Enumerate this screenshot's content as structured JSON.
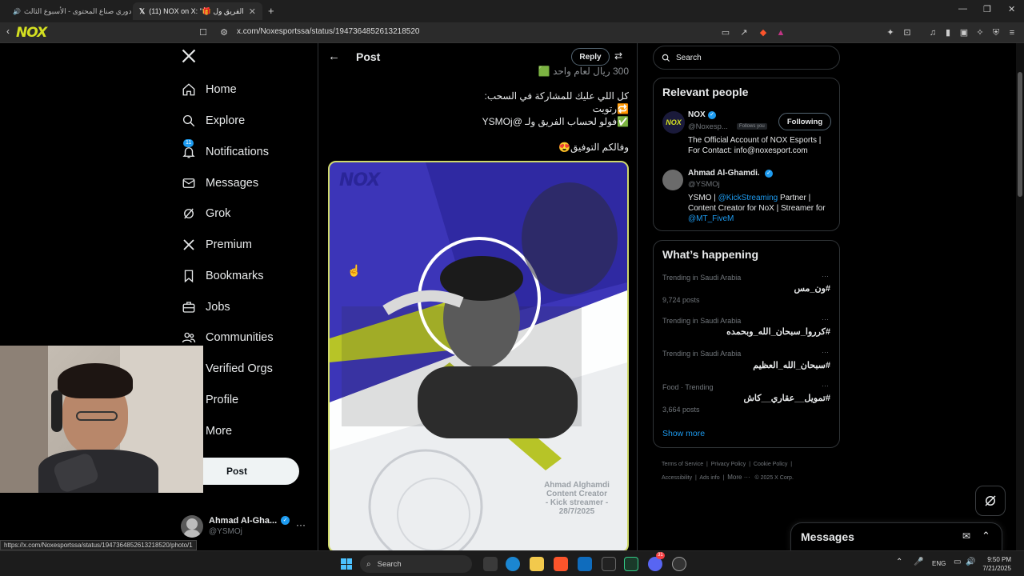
{
  "browser": {
    "tabs": [
      {
        "title": "دوري صناع المحتوى - الأسبوع الثالث",
        "active": false
      },
      {
        "title": "(11) NOX on X: \"🎁 ب الفريق ول",
        "active": true
      }
    ],
    "url": "x.com/Noxesportssa/status/1947364852613218520",
    "status_url": "https://x.com/Noxesportssa/status/1947364852613218520/photo/1"
  },
  "nav": {
    "items": [
      {
        "label": "Home",
        "icon": "home-icon"
      },
      {
        "label": "Explore",
        "icon": "search-icon"
      },
      {
        "label": "Notifications",
        "icon": "bell-icon",
        "badge": "11"
      },
      {
        "label": "Messages",
        "icon": "mail-icon"
      },
      {
        "label": "Grok",
        "icon": "grok-icon"
      },
      {
        "label": "Premium",
        "icon": "x-logo-icon"
      },
      {
        "label": "Bookmarks",
        "icon": "bookmark-icon"
      },
      {
        "label": "Jobs",
        "icon": "briefcase-icon"
      },
      {
        "label": "Communities",
        "icon": "people-icon"
      },
      {
        "label": "Verified Orgs",
        "icon": "verified-icon"
      },
      {
        "label": "Profile",
        "icon": "profile-icon"
      },
      {
        "label": "More",
        "icon": "more-icon"
      }
    ],
    "post_button": "Post",
    "account": {
      "name": "Ahmad Al-Gha...",
      "handle": "@YSMOj"
    }
  },
  "post": {
    "header_title": "Post",
    "reply_label": "Reply",
    "lines": [
      "كل اللي عليك للمشاركة في السحب:",
      "🔁رتويت",
      "✅فولو لحساب الفريق ولـ @YSMOj",
      "وفالكم التوفيق😍"
    ],
    "top_partial": "300 ريال لعام واحد 🟩",
    "image": {
      "logo": "NOX",
      "caption": [
        "Ahmad Alghamdi",
        "Content Creator",
        "- Kick streamer -",
        "28/7/2025"
      ]
    }
  },
  "search": {
    "placeholder": "Search"
  },
  "relevant_people": {
    "title": "Relevant people",
    "people": [
      {
        "name": "NOX",
        "handle": "@Noxesp...",
        "follows_you": "Follows you",
        "button": "Following",
        "bio": "The Official Account of NOX Esports | For Contact: info@noxesport.com"
      },
      {
        "name": "Ahmad Al-Ghamdi.",
        "handle": "@YSMOj",
        "bio_prefix": "YSMO | ",
        "bio_link1": "@KickStreaming",
        "bio_mid": " Partner | Content Creator for NoX | Streamer for ",
        "bio_link2": "@MT_FiveM"
      }
    ]
  },
  "happening": {
    "title": "What’s happening",
    "trends": [
      {
        "context": "Trending in Saudi Arabia",
        "tag": "#ون_مس",
        "posts": "9,724 posts"
      },
      {
        "context": "Trending in Saudi Arabia",
        "tag": "#كرروا_سبحان_الله_وبحمده",
        "posts": ""
      },
      {
        "context": "Trending in Saudi Arabia",
        "tag": "#سبحان_الله_العظيم",
        "posts": ""
      },
      {
        "context": "Food · Trending",
        "tag": "#تمويل__عقاري__كاش",
        "posts": "3,664 posts"
      }
    ],
    "show_more": "Show more"
  },
  "footer": {
    "links": [
      "Terms of Service",
      "Privacy Policy",
      "Cookie Policy",
      "Accessibility",
      "Ads info",
      "More ···",
      "© 2025 X Corp."
    ]
  },
  "messages_drawer": {
    "title": "Messages"
  },
  "taskbar": {
    "search": "Search",
    "language": "ENG",
    "time": "9:50 PM",
    "date": "7/21/2025",
    "discord_badge": "31"
  },
  "colors": {
    "accent": "#1d9bf0",
    "nox_yellow": "#d4e021",
    "poster_blue": "#3c35b8"
  }
}
